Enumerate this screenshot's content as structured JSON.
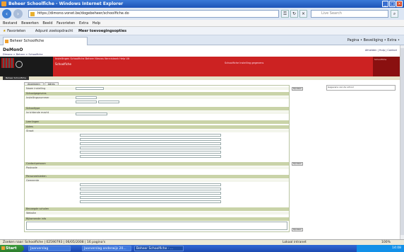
{
  "window": {
    "title": "Beheer Schoolfiche - Windows Internet Explorer"
  },
  "address": {
    "url": "https://dimono.vonet.be/dogebeheer/schoolfiche.do",
    "search_placeholder": "Live Search"
  },
  "menu": [
    "Bestand",
    "Bewerken",
    "Beeld",
    "Favorieten",
    "Extra",
    "Help"
  ],
  "favorites": {
    "label": "Favorieten",
    "item1": "Adpunt zoekopdracht",
    "item2": "Meer toevoegingsopties"
  },
  "tab": {
    "label": "Beheer Schoolfiche"
  },
  "commandbar": "Pagina •  Beveiliging •  Extra •",
  "page": {
    "logo": "DeMonO",
    "crumb": "Dimono > Beheer > Schoolfiche",
    "rightlinks": "Afmelden | Hulp | Contact",
    "hb_menu": "Instellingen  Schoolfiche  Beheer  Nieuws  Kennisbank  Help  Uit",
    "hb_title": "Schoolfiche",
    "hb_right": "Schoolfiche Instelling gegevens",
    "hb_box": "Schoolfiche",
    "subbar_label": "Beheer Schoolfiche",
    "form_tabs": [
      "Algemeen",
      "Adres"
    ],
    "sections": [
      "Schoolgegevens",
      "Schooltype",
      "Leerlingen",
      "Adres",
      "Contactpersoon",
      "Personeelsleden",
      "Bevoegde scholen",
      "Bijkomende info"
    ],
    "rows": [
      "Naam instelling",
      "Instellingsnummer",
      "Inrichtende macht",
      "Straat",
      "Postcode",
      "Gemeente",
      "Telefoon",
      "Fax",
      "Email",
      "Website",
      "Opmerking"
    ],
    "button_save": "Opslaan",
    "rightpanel": "Gegevens van de school"
  },
  "status": {
    "text": "Zoeken naar: Schoolfiche | 02590793 | 06/05/2008 | 16 pagina's",
    "zone": "Lokaal intranet",
    "zoom": "100%"
  },
  "taskbar": {
    "start": "Start",
    "tasks": [
      "Jaarverslag",
      "Jaarverslag onderwijs 20...",
      "Beheer Schoolfiche - ..."
    ],
    "clock": "14:08"
  }
}
